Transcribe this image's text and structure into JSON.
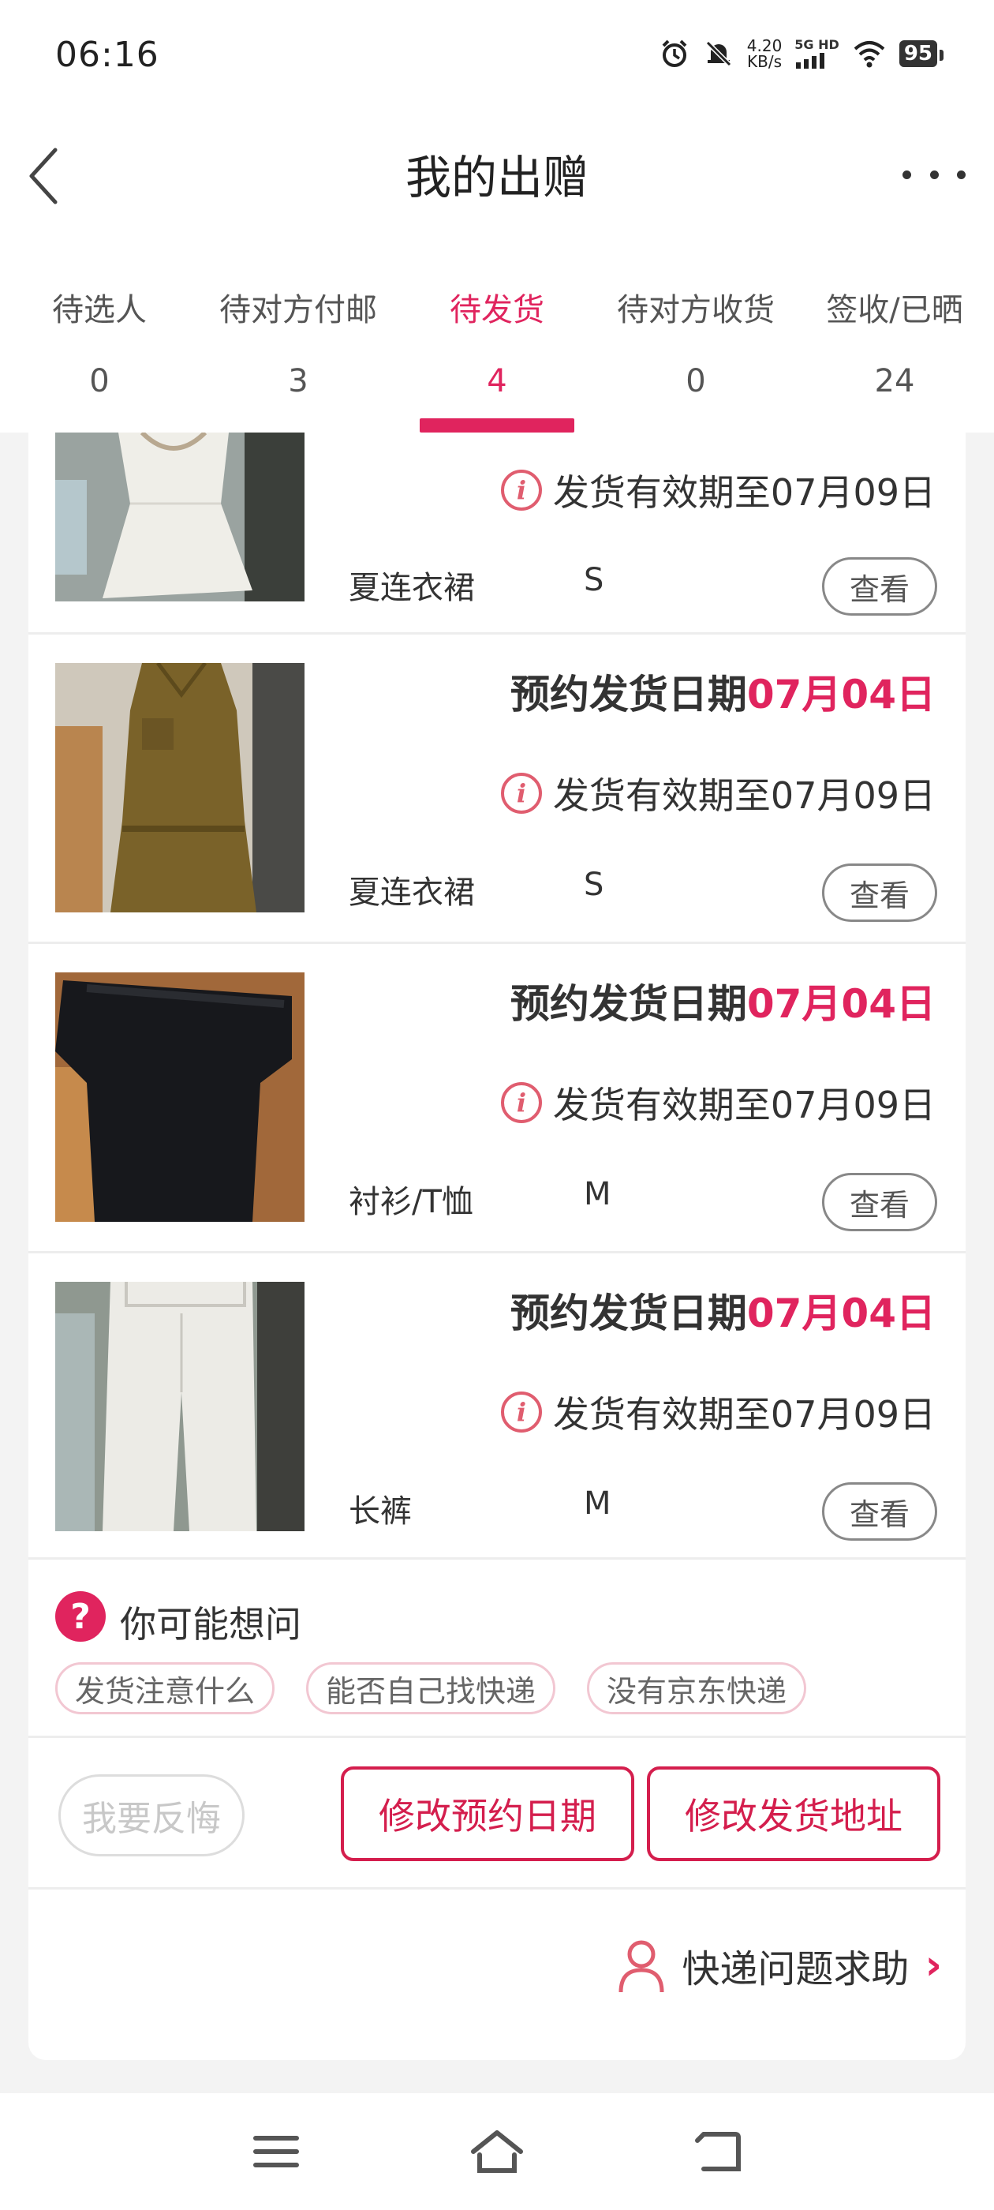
{
  "status_bar": {
    "time": "06:16",
    "net_speed_value": "4.20",
    "net_speed_unit": "KB/s",
    "signal": "5G HD",
    "battery": "95"
  },
  "header": {
    "title": "我的出赠"
  },
  "tabs": [
    {
      "label": "待选人",
      "count": "0",
      "active": false
    },
    {
      "label": "待对方付邮",
      "count": "3",
      "active": false
    },
    {
      "label": "待发货",
      "count": "4",
      "active": true
    },
    {
      "label": "待对方收货",
      "count": "0",
      "active": false
    },
    {
      "label": "签收/已晒",
      "count": "24",
      "active": false
    }
  ],
  "items": [
    {
      "image": "white-dress-photo",
      "schedule_label": "",
      "schedule_date": "",
      "validity": "发货有效期至07月09日",
      "category": "夏连衣裙",
      "size": "S",
      "view_label": "查看"
    },
    {
      "image": "khaki-jumpsuit-photo",
      "schedule_label": "预约发货日期",
      "schedule_date": "07月04日",
      "validity": "发货有效期至07月09日",
      "category": "夏连衣裙",
      "size": "S",
      "view_label": "查看"
    },
    {
      "image": "black-top-photo",
      "schedule_label": "预约发货日期",
      "schedule_date": "07月04日",
      "validity": "发货有效期至07月09日",
      "category": "衬衫/T恤",
      "size": "M",
      "view_label": "查看"
    },
    {
      "image": "white-pants-photo",
      "schedule_label": "预约发货日期",
      "schedule_date": "07月04日",
      "validity": "发货有效期至07月09日",
      "category": "长裤",
      "size": "M",
      "view_label": "查看"
    }
  ],
  "faq": {
    "title": "你可能想问",
    "chips": [
      "发货注意什么",
      "能否自己找快递",
      "没有京东快递"
    ]
  },
  "actions": {
    "regret": "我要反悔",
    "change_date": "修改预约日期",
    "change_address": "修改发货地址"
  },
  "help": {
    "label": "快递问题求助"
  },
  "colors": {
    "accent": "#e0245e",
    "button_border": "#d41e4d",
    "text": "#333333",
    "background": "#f3f3f3"
  }
}
